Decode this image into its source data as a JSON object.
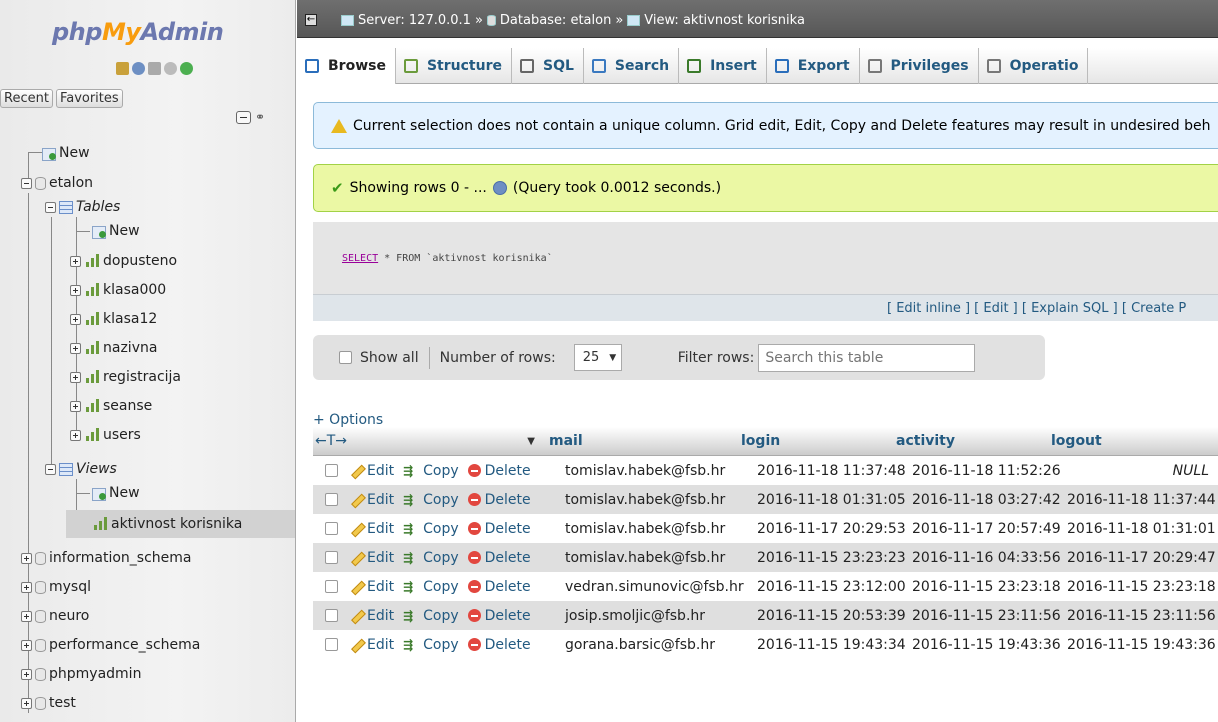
{
  "logo": {
    "part1": "php",
    "part2": "My",
    "part3": "Admin"
  },
  "nav": {
    "recent": "Recent",
    "favorites": "Favorites",
    "tree": {
      "new_db": "New",
      "etalon": "etalon",
      "tables": "Tables",
      "tables_new": "New",
      "table_items": [
        "dopusteno",
        "klasa000",
        "klasa12",
        "nazivna",
        "registracija",
        "seanse",
        "users"
      ],
      "views": "Views",
      "views_new": "New",
      "view_selected": "aktivnost korisnika",
      "databases": [
        "information_schema",
        "mysql",
        "neuro",
        "performance_schema",
        "phpmyadmin",
        "test"
      ]
    }
  },
  "breadcrumb": {
    "server": "Server: 127.0.0.1",
    "sep": "»",
    "database": "Database: etalon",
    "view": "View: aktivnost korisnika"
  },
  "tabs": [
    "Browse",
    "Structure",
    "SQL",
    "Search",
    "Insert",
    "Export",
    "Privileges",
    "Operatio"
  ],
  "warning_text": "Current selection does not contain a unique column. Grid edit, Edit, Copy and Delete features may result in undesired beh",
  "success": {
    "showing": "Showing rows 0 - ...",
    "query_took": "(Query took 0.0012 seconds.)"
  },
  "sql": {
    "select": "SELECT",
    "rest": " * FROM ",
    "table": "`aktivnost korisnika`"
  },
  "sql_links": "[ Edit inline ] [ Edit ] [ Explain SQL ] [ Create P",
  "filter": {
    "show_all": "Show all",
    "number_of_rows": "Number of rows:",
    "rows_value": "25",
    "filter_rows": "Filter rows:",
    "search_placeholder": "Search this table"
  },
  "options_label": "+ Options",
  "columns": {
    "arrows": "←T→",
    "sort": "▼",
    "mail": "mail",
    "login": "login",
    "activity": "activity",
    "logout": "logout"
  },
  "actions": {
    "edit": "Edit",
    "copy": "Copy",
    "delete": "Delete"
  },
  "rows": [
    {
      "mail": "tomislav.habek@fsb.hr",
      "login": "2016-11-18 11:37:48",
      "activity": "2016-11-18 11:52:26",
      "logout": "NULL"
    },
    {
      "mail": "tomislav.habek@fsb.hr",
      "login": "2016-11-18 01:31:05",
      "activity": "2016-11-18 03:27:42",
      "logout": "2016-11-18 11:37:44"
    },
    {
      "mail": "tomislav.habek@fsb.hr",
      "login": "2016-11-17 20:29:53",
      "activity": "2016-11-17 20:57:49",
      "logout": "2016-11-18 01:31:01"
    },
    {
      "mail": "tomislav.habek@fsb.hr",
      "login": "2016-11-15 23:23:23",
      "activity": "2016-11-16 04:33:56",
      "logout": "2016-11-17 20:29:47"
    },
    {
      "mail": "vedran.simunovic@fsb.hr",
      "login": "2016-11-15 23:12:00",
      "activity": "2016-11-15 23:23:18",
      "logout": "2016-11-15 23:23:18"
    },
    {
      "mail": "josip.smoljic@fsb.hr",
      "login": "2016-11-15 20:53:39",
      "activity": "2016-11-15 23:11:56",
      "logout": "2016-11-15 23:11:56"
    },
    {
      "mail": "gorana.barsic@fsb.hr",
      "login": "2016-11-15 19:43:34",
      "activity": "2016-11-15 19:43:36",
      "logout": "2016-11-15 19:43:36"
    }
  ],
  "colors": {
    "link": "#235a81",
    "warning_bg": "#e4f2ff",
    "success_bg": "#ebf8a4",
    "topbar": "#666666"
  }
}
